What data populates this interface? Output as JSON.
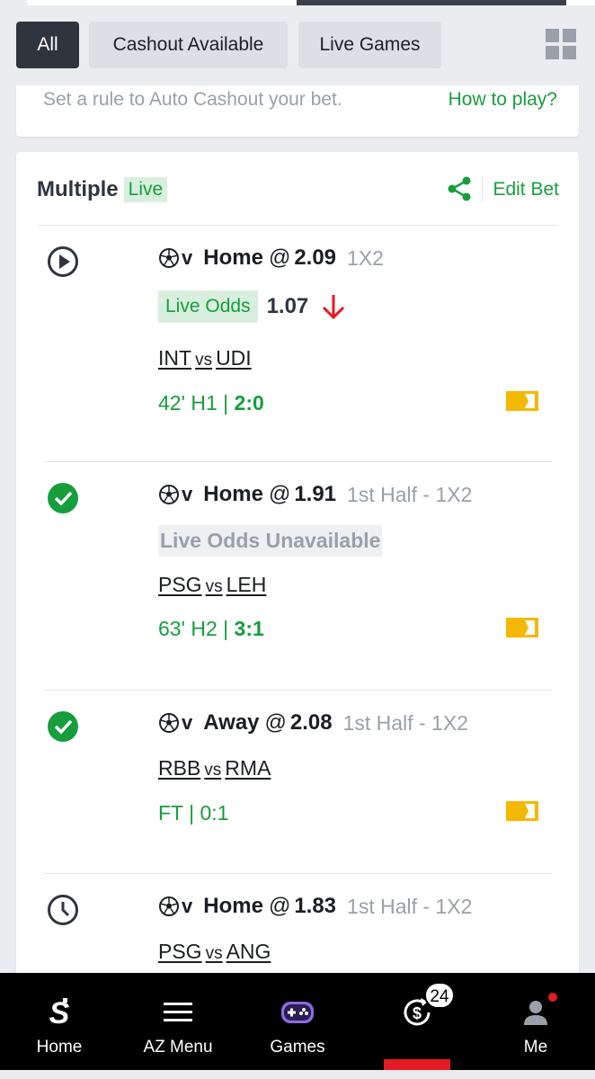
{
  "filters": {
    "all_label": "All",
    "cashout_label": "Cashout Available",
    "live_label": "Live Games",
    "grid_icon": "grid-view-icon"
  },
  "auto_cashout": {
    "hint": "Set a rule to Auto Cashout your bet.",
    "how_to_play": "How to play?"
  },
  "bet": {
    "title": "Multiple",
    "live_badge": "Live",
    "edit_label": "Edit Bet",
    "share_icon": "share-icon",
    "selections": [
      {
        "status_icon": "play-circle-icon",
        "v_prefix": "v",
        "pick": "Home",
        "at": "@",
        "odds": "2.09",
        "market": "1X2",
        "live_odds_label": "Live Odds",
        "live_odds_value": "1.07",
        "live_odds_trend": "down",
        "home": "INT",
        "vs": "vs",
        "away": "UDI",
        "score_time": "42' H1 | ",
        "score_value": "2:0"
      },
      {
        "status_icon": "check-circle-icon",
        "v_prefix": "v",
        "pick": "Home",
        "at": "@",
        "odds": "1.91",
        "market": "1st Half - 1X2",
        "unavailable_label": "Live Odds Unavailable",
        "home": "PSG",
        "vs": "vs",
        "away": "LEH",
        "score_time": "63' H2 | ",
        "score_value": "3:1"
      },
      {
        "status_icon": "check-circle-icon",
        "v_prefix": "v",
        "pick": "Away",
        "at": "@",
        "odds": "2.08",
        "market": "1st Half - 1X2",
        "home": "RBB",
        "vs": "vs",
        "away": "RMA",
        "score_time": "FT | 0:1"
      },
      {
        "status_icon": "clock-icon",
        "v_prefix": "v",
        "pick": "Home",
        "at": "@",
        "odds": "1.83",
        "market": "1st Half - 1X2",
        "home": "PSG",
        "vs": "vs",
        "away": "ANG"
      }
    ]
  },
  "nav": {
    "home": "Home",
    "az_menu": "AZ Menu",
    "games": "Games",
    "cashout_count": "24",
    "me": "Me"
  },
  "colors": {
    "accent_green": "#169e3c",
    "alert_red": "#e41a24",
    "tag_yellow": "#f5b800",
    "dark_chip": "#2f353f"
  }
}
